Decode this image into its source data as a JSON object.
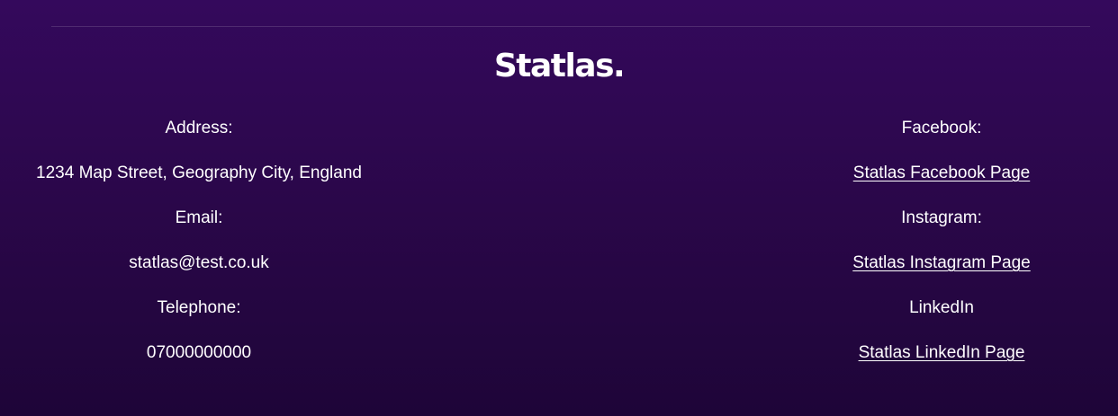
{
  "brand": {
    "logo_text": "Statlas."
  },
  "contact": {
    "address_label": "Address:",
    "address_value": "1234 Map Street, Geography City, England",
    "email_label": "Email:",
    "email_value": "statlas@test.co.uk",
    "telephone_label": "Telephone:",
    "telephone_value": "07000000000"
  },
  "social": {
    "facebook_label": "Facebook:",
    "facebook_link": "Statlas Facebook Page",
    "instagram_label": "Instagram:",
    "instagram_link": "Statlas Instagram Page",
    "linkedin_label": "LinkedIn",
    "linkedin_link": "Statlas LinkedIn Page"
  },
  "colors": {
    "background_top": "#34095c",
    "background_bottom": "#1e0538",
    "text": "#ffffff"
  }
}
